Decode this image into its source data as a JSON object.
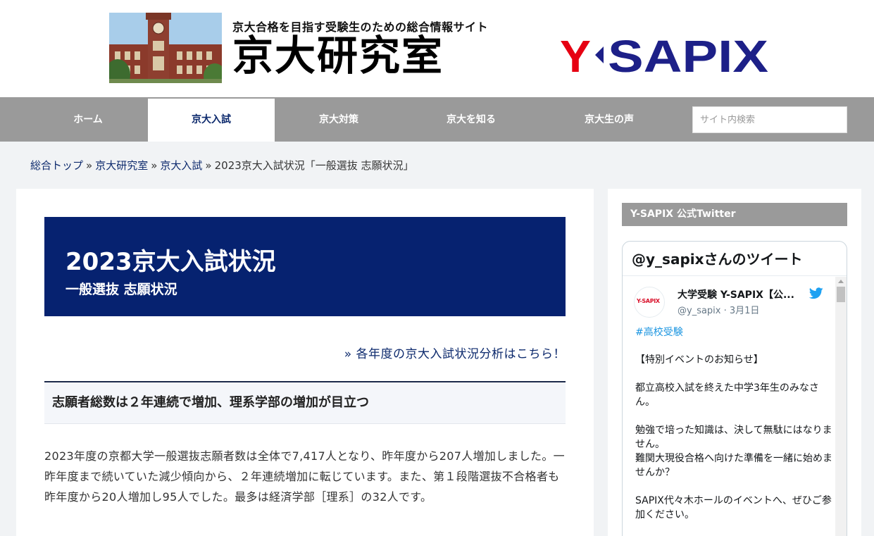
{
  "header": {
    "tagline": "京大合格を目指す受験生のための総合情報サイト",
    "site_title": "京大研究室",
    "brand_logo": "Y-SAPIX",
    "brand_colors": {
      "red": "#e60012",
      "navy": "#1d2088"
    }
  },
  "nav": {
    "items": [
      {
        "label": "ホーム",
        "active": false
      },
      {
        "label": "京大入試",
        "active": true
      },
      {
        "label": "京大対策",
        "active": false
      },
      {
        "label": "京大を知る",
        "active": false
      },
      {
        "label": "京大生の声",
        "active": false
      }
    ],
    "search_placeholder": "サイト内検索"
  },
  "breadcrumb": {
    "items": [
      "総合トップ",
      "京大研究室",
      "京大入試"
    ],
    "separator": "»",
    "current": "2023京大入試状況「一般選抜 志願状況」"
  },
  "main": {
    "title": "2023京大入試状況",
    "subtitle": "一般選抜 志願状況",
    "yearly_link": "» 各年度の京大入試状況分析はこちら！",
    "section_heading": "志願者総数は２年連続で増加、理系学部の増加が目立つ",
    "body_text": "2023年度の京都大学一般選抜志願者数は全体で7,417人となり、昨年度から207人増加しました。一昨年度まで続いていた減少傾向から、２年連続増加に転じています。また、第１段階選抜不合格者も昨年度から20人増加し95人でした。最多は経済学部［理系］の32人です。",
    "accent_color": "#062270"
  },
  "sidebar": {
    "widget_title": "Y-SAPIX 公式Twitter",
    "timeline_header": "@y_sapixさんのツイート",
    "tweet": {
      "avatar_text": "Y-SAPIX",
      "name": "大学受験 Y-SAPIX【公...",
      "handle": "@y_sapix · 3月1日",
      "hashtag": "#高校受験",
      "body": "【特別イベントのお知らせ】\n\n都立高校入試を終えた中学3年生のみなさん。\n\n勉強で培った知識は、決して無駄にはなりません。\n難関大現役合格へ向けた準備を一緒に始めませんか？\n\nSAPIX代々木ホールのイベントへ、ぜひご参加ください。",
      "icon": "twitter-bird-icon"
    }
  }
}
